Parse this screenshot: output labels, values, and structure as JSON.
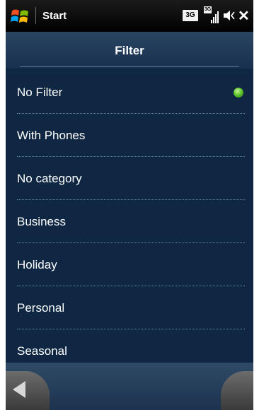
{
  "status_bar": {
    "title": "Start",
    "network_badge": "3G",
    "signal_badge": "3G",
    "close_glyph": "✕"
  },
  "header": {
    "title": "Filter"
  },
  "filter_list": {
    "items": [
      {
        "label": "No Filter",
        "selected": true
      },
      {
        "label": "With Phones",
        "selected": false
      },
      {
        "label": "No category",
        "selected": false
      },
      {
        "label": "Business",
        "selected": false
      },
      {
        "label": "Holiday",
        "selected": false
      },
      {
        "label": "Personal",
        "selected": false
      },
      {
        "label": "Seasonal",
        "selected": false
      }
    ],
    "selected_indicator_color": "#5fc62c"
  },
  "softkeys": {
    "left_icon": "back-arrow-icon",
    "right_icon": "softkey-right"
  },
  "colors": {
    "background": "#0f2743",
    "status_bar": "#000000",
    "text": "#ffffff"
  }
}
